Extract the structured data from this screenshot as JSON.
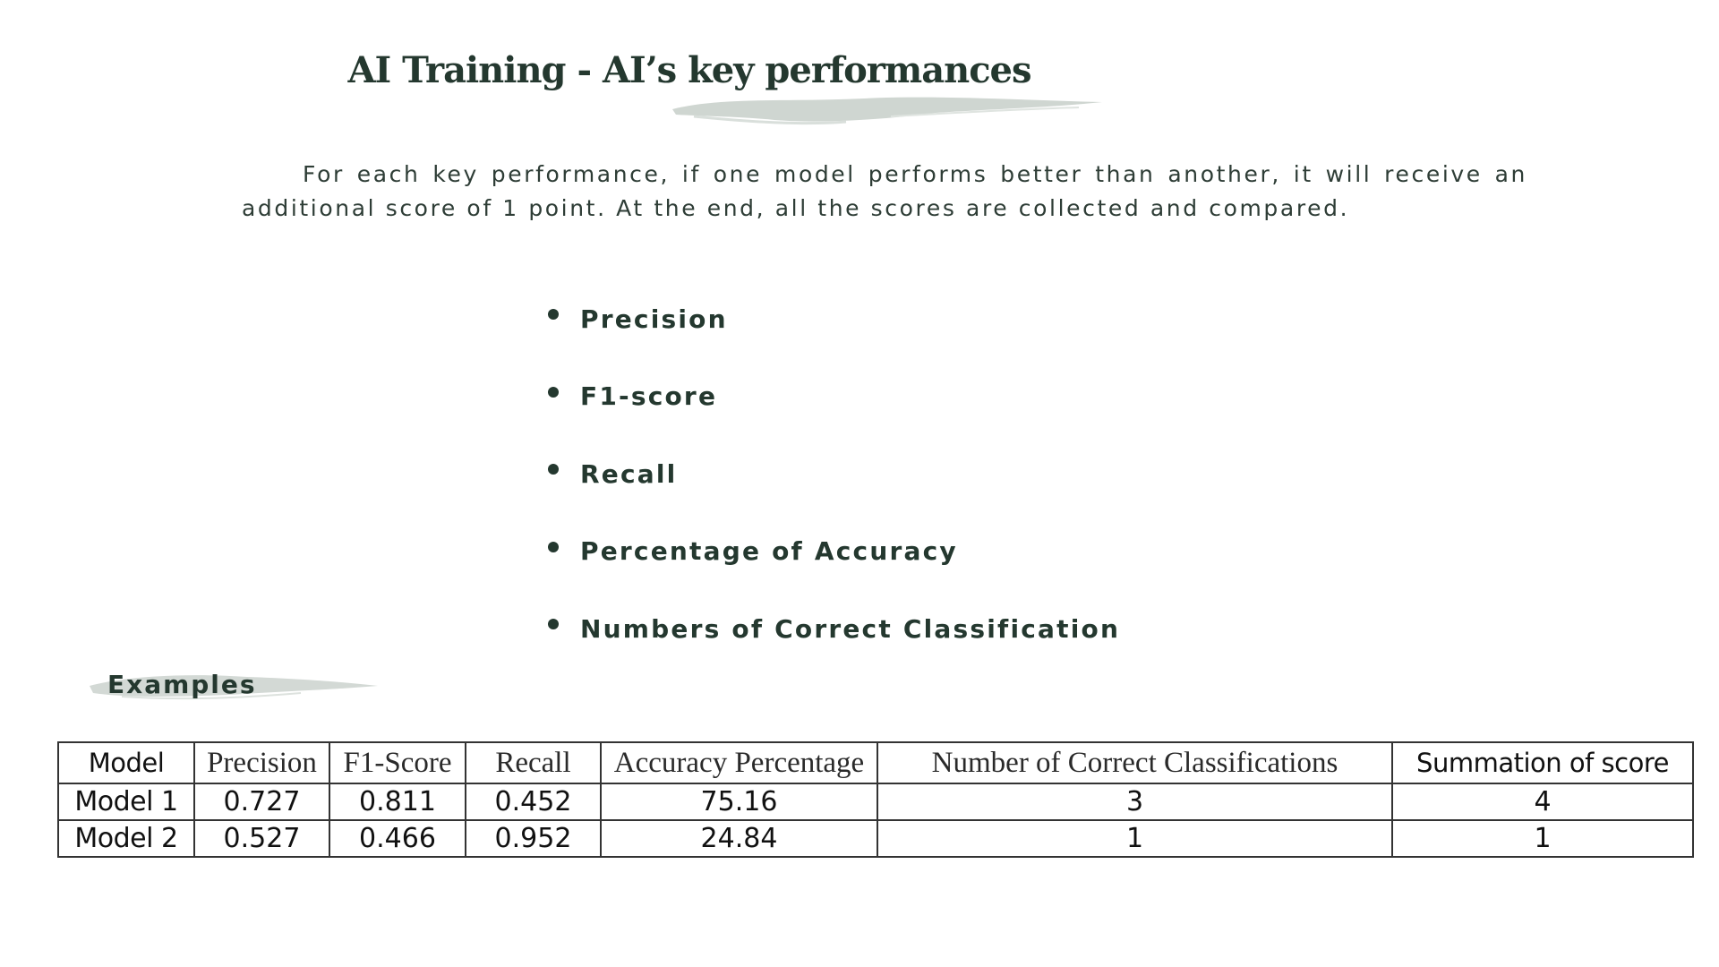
{
  "title": "AI Training -  AI’s key performances",
  "intro": "For each key performance, if one model performs better than another, it will receive an additional score of 1 point. At the end, all the scores are collected and compared.",
  "key_performances": [
    "Precision",
    "F1-score",
    "Recall",
    "Percentage of Accuracy",
    "Numbers of Correct Classification"
  ],
  "examples_heading": "Examples",
  "table": {
    "headers": [
      "Model",
      "Precision",
      "F1-Score",
      "Recall",
      "Accuracy Percentage",
      "Number of Correct Classifications",
      "Summation of score"
    ],
    "rows": [
      [
        "Model 1",
        "0.727",
        "0.811",
        "0.452",
        "75.16",
        "3",
        "4"
      ],
      [
        "Model 2",
        "0.527",
        "0.466",
        "0.952",
        "24.84",
        "1",
        "1"
      ]
    ]
  },
  "colors": {
    "text_primary": "#24382f",
    "brush": "#cfd6d1",
    "table_border": "#333333"
  }
}
